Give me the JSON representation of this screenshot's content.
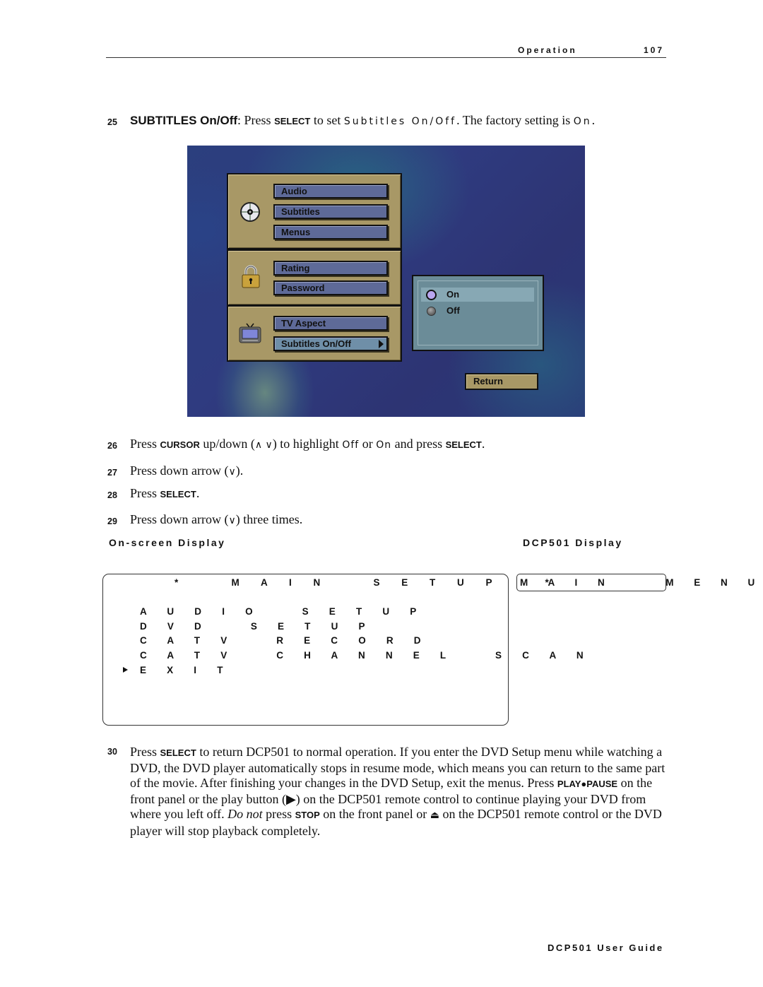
{
  "header": {
    "section": "Operation",
    "page": "107"
  },
  "steps": {
    "s25": {
      "num": "25",
      "title": "SUBTITLES On/Off",
      "t1": ": Press ",
      "kw1": "SELECT",
      "t2": " to set ",
      "scr1": "Subtitles On/Off",
      "t3": ". The factory setting is ",
      "scr2": "On",
      "t4": "."
    },
    "s26": {
      "num": "26",
      "t1": "Press ",
      "kw1": "CURSOR",
      "t2": " up/down (",
      "sym": "∧ ∨",
      "t3": ") to highlight ",
      "scr1": "Off",
      "t4": " or ",
      "scr2": "On",
      "t5": " and press ",
      "kw2": "SELECT",
      "t6": "."
    },
    "s27": {
      "num": "27",
      "t1": "Press down arrow (",
      "sym": "∨",
      "t2": ")."
    },
    "s28": {
      "num": "28",
      "t1": "Press ",
      "kw1": "SELECT",
      "t2": "."
    },
    "s29": {
      "num": "29",
      "t1": "Press down arrow (",
      "sym": "∨",
      "t2": ") three times."
    },
    "s30": {
      "num": "30",
      "t1": "Press ",
      "kw1": "SELECT",
      "t2": " to return DCP501 to normal operation. If you enter the DVD Setup menu while watching a DVD, the DVD player automatically stops in resume mode, which means you can return to the same part of the movie. After finishing your changes in the DVD Setup, exit the menus. Press ",
      "kw2": "PLAY●PAUSE",
      "t3": " on the front panel or the play button (▶) on the DCP501 remote control to continue playing your DVD from where you left off. ",
      "em": "Do not",
      "t4": " press ",
      "kw3": "STOP",
      "t5": " on the front panel or ",
      "eject": "⏏",
      "t6": " on the DCP501 remote control or the DVD player will stop playback completely."
    }
  },
  "dvd_menu": {
    "groups": [
      {
        "icon": "disc-icon",
        "items": [
          "Audio",
          "Subtitles",
          "Menus"
        ]
      },
      {
        "icon": "lock-icon",
        "items": [
          "Rating",
          "Password"
        ]
      },
      {
        "icon": "tv-icon",
        "items": [
          "TV Aspect",
          "Subtitles On/Off"
        ]
      }
    ],
    "active_item": "Subtitles On/Off",
    "options": [
      {
        "label": "On",
        "selected": true
      },
      {
        "label": "Off",
        "selected": false
      }
    ],
    "return_label": "Return",
    "colors": {
      "panel": "#a89866",
      "button": "#5e6a98",
      "options_bg": "#6b8c98",
      "radio_on": "#b9a6ef"
    }
  },
  "displays": {
    "onscreen_heading": "On-screen Display",
    "dcp501_heading": "DCP501 Display",
    "osd_title": "*   M A I N   S E T U P   *",
    "osd_lines": [
      "A U D I O   S E T U P",
      "D V D   S E T U P",
      "C A T V   R E C O R D",
      "C A T V   C H A N N E L   S C A N",
      "E X I T"
    ],
    "osd_selected": "E X I T",
    "lcd_text": "M A I N    M E N U"
  },
  "footer": {
    "text": "DCP501 User Guide"
  }
}
